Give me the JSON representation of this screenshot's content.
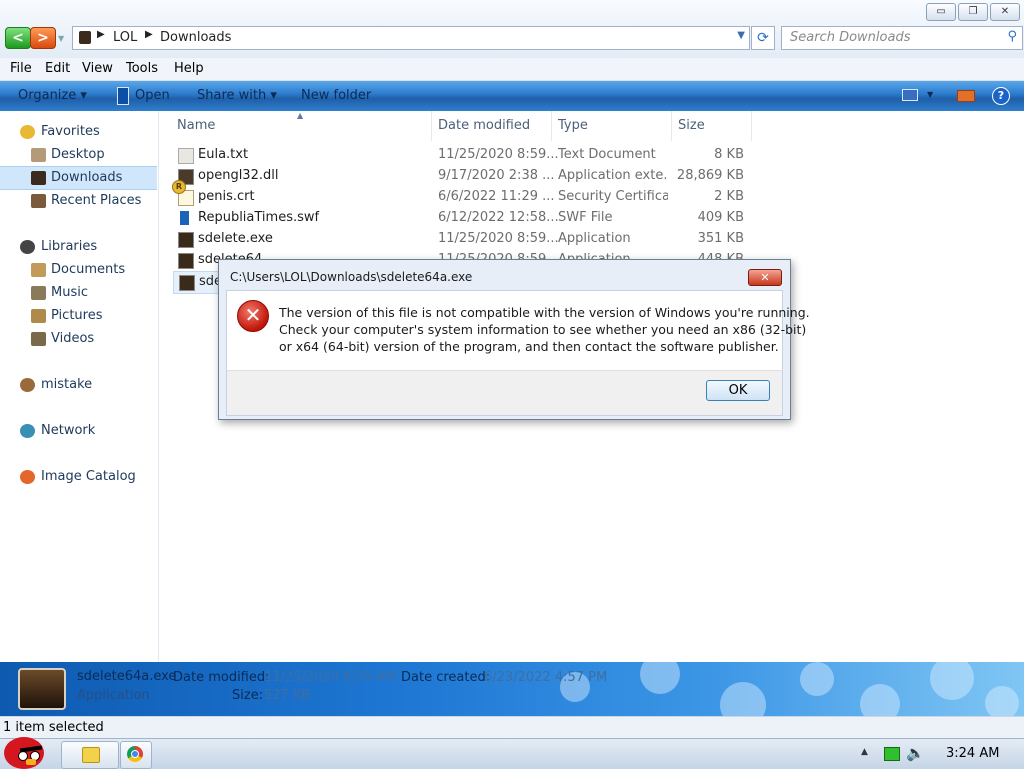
{
  "window": {
    "buttons": {
      "minimize": "▭",
      "maximize": "❐",
      "close": "✕"
    },
    "address": {
      "crumbs": [
        "LOL",
        "Downloads"
      ]
    },
    "search": {
      "placeholder": "Search Downloads"
    }
  },
  "menu": [
    "File",
    "Edit",
    "View",
    "Tools",
    "Help"
  ],
  "commands": {
    "organize": "Organize ▾",
    "open": "Open",
    "share_with": "Share with ▾",
    "new_folder": "New folder"
  },
  "nav": {
    "favorites": {
      "label": "Favorites",
      "items": [
        "Desktop",
        "Downloads",
        "Recent Places"
      ]
    },
    "libraries": {
      "label": "Libraries",
      "items": [
        "Documents",
        "Music",
        "Pictures",
        "Videos"
      ]
    },
    "mistake": "mistake",
    "network": "Network",
    "image_catalog": "Image Catalog"
  },
  "columns": [
    "Name",
    "Date modified",
    "Type",
    "Size"
  ],
  "files": [
    {
      "name": "Eula.txt",
      "date": "11/25/2020 8:59...",
      "type": "Text Document",
      "size": "8 KB",
      "icon": "text-file-icon"
    },
    {
      "name": "opengl32.dll",
      "date": "9/17/2020 2:38 ...",
      "type": "Application exte...",
      "size": "28,869 KB",
      "icon": "dll-file-icon"
    },
    {
      "name": "penis.crt",
      "date": "6/6/2022 11:29 ...",
      "type": "Security Certifica...",
      "size": "2 KB",
      "icon": "certificate-icon"
    },
    {
      "name": "RepubliaTimes.swf",
      "date": "6/12/2022 12:58...",
      "type": "SWF File",
      "size": "409 KB",
      "icon": "swf-file-icon"
    },
    {
      "name": "sdelete.exe",
      "date": "11/25/2020 8:59...",
      "type": "Application",
      "size": "351 KB",
      "icon": "exe-file-icon"
    },
    {
      "name": "sdelete64...",
      "date": "11/25/2020 8:59...",
      "type": "Application",
      "size": "448 KB",
      "icon": "exe-file-icon"
    },
    {
      "name": "sdelete64a.exe",
      "date": "",
      "type": "",
      "size": "",
      "icon": "exe-file-icon"
    }
  ],
  "details": {
    "filename": "sdelete64a.exe",
    "type": "Application",
    "date_modified_label": "Date modified:",
    "date_modified": "11/25/2020 8:59 AM",
    "date_created_label": "Date created:",
    "date_created": "6/23/2022 4:57 PM",
    "size_label": "Size:",
    "size": "527 KB"
  },
  "status": "1 item selected",
  "dialog": {
    "title": "C:\\Users\\LOL\\Downloads\\sdelete64a.exe",
    "message_lines": [
      "The version of this file is not compatible with the version of Windows you're running.",
      "Check your computer's system information to see whether you need an x86 (32-bit)",
      "or x64 (64-bit) version of the program, and then contact the software publisher."
    ],
    "ok": "OK",
    "close": "✕",
    "icon": "error-icon"
  },
  "taskbar": {
    "clock": "3:24 AM"
  },
  "colors": {
    "commandbar": "#2f7fd0",
    "details_pane": "#1e78d4",
    "error": "#c0150a",
    "selection": "#cfe6fb"
  }
}
